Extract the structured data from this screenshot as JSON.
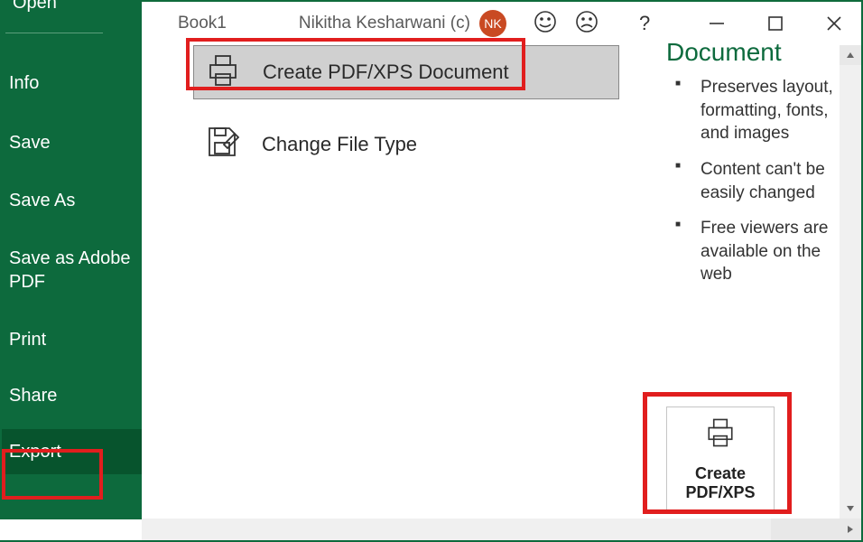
{
  "header": {
    "doc_title": "Book1",
    "user_name": "Nikitha Kesharwani (c)",
    "avatar_initials": "NK"
  },
  "sidebar": {
    "open": "Open",
    "info": "Info",
    "save": "Save",
    "save_as": "Save As",
    "save_adobe": "Save as Adobe PDF",
    "print": "Print",
    "share": "Share",
    "export": "Export"
  },
  "options": {
    "create_pdf": "Create PDF/XPS Document",
    "change_type": "Change File Type"
  },
  "right": {
    "heading": "Document",
    "b1": "Preserves layout, formatting, fonts, and images",
    "b2": "Content can't be easily changed",
    "b3": "Free viewers are available on the web"
  },
  "button": {
    "label": "Create PDF/XPS"
  }
}
